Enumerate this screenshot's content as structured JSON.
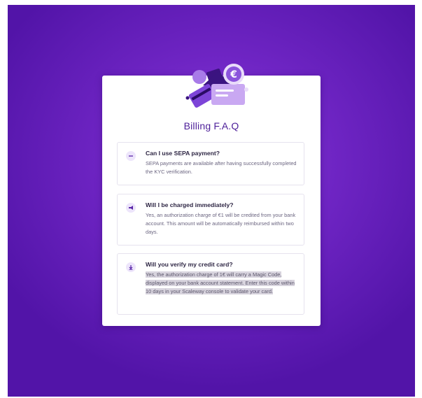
{
  "page": {
    "title": "Billing F.A.Q"
  },
  "faq": [
    {
      "icon": "minus-icon",
      "question": "Can I use SEPA payment?",
      "answer": "SEPA payments are available after having successfully completed the KYC verification."
    },
    {
      "icon": "megaphone-icon",
      "question": "Will I be charged immediately?",
      "answer": "Yes, an authorization charge of €1 will be credited from your bank account. This amount will be automatically reimbursed within two days."
    },
    {
      "icon": "arrow-down-icon",
      "question": "Will you verify my credit card?",
      "answer": "Yes, the authorization charge of 1€ will carry a Magic Code, displayed on your bank account statement. Enter this code within 10 days in your Scaleway console to validate your card."
    }
  ],
  "illustration": {
    "coin_symbol": "€"
  },
  "colors": {
    "background": "#6f25c4",
    "title": "#4d1f99",
    "accent": "#7a3ad0"
  }
}
